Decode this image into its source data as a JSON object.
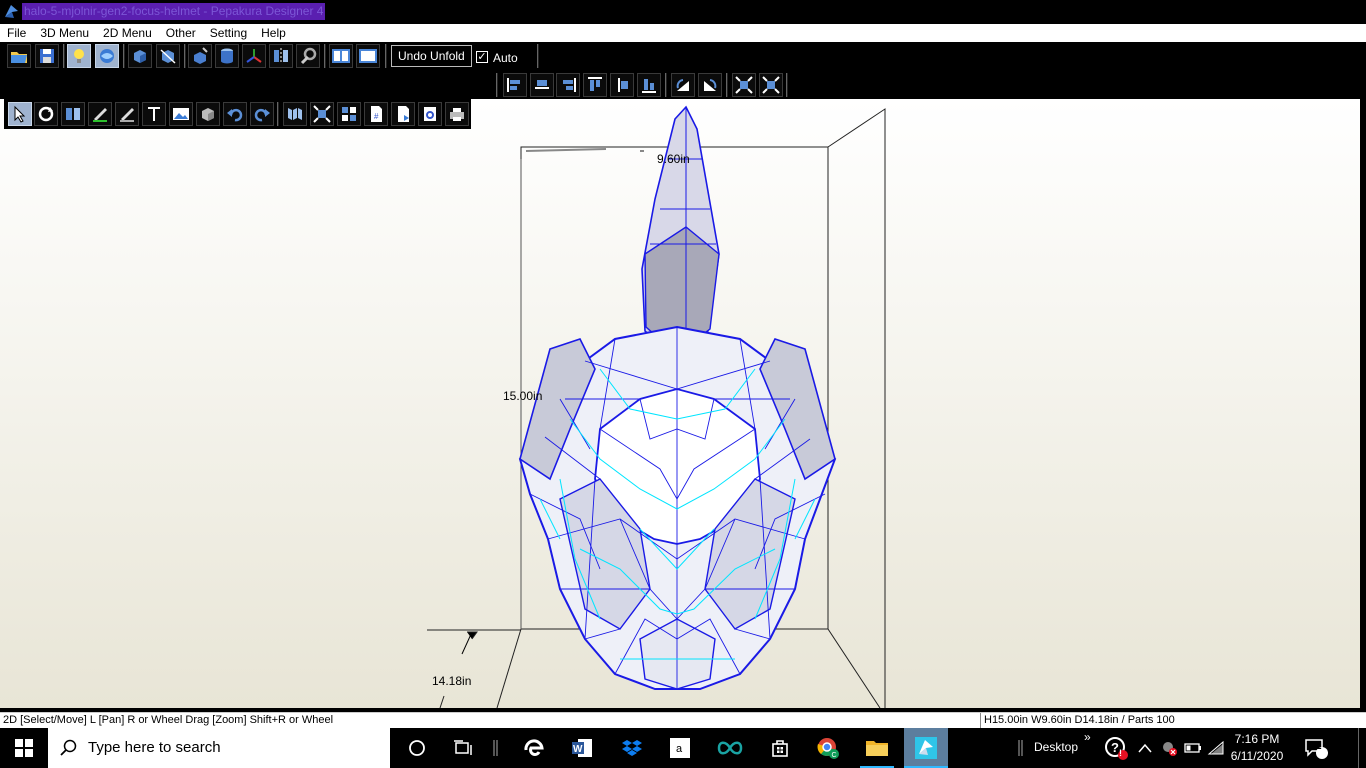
{
  "window": {
    "title": "halo-5-mjolnir-gen2-focus-helmet - Pepakura Designer 4"
  },
  "menu": [
    "File",
    "3D Menu",
    "2D Menu",
    "Other",
    "Setting",
    "Help"
  ],
  "toolbar_main": {
    "undo_unfold": "Undo Unfold",
    "auto_label": "Auto",
    "auto_checked": "✓",
    "icons": [
      "open-icon",
      "save-icon",
      "light-icon",
      "texture-icon",
      "select-face-icon",
      "edge-icon",
      "cut-icon",
      "cylinder-icon",
      "axis-icon",
      "mirror-icon",
      "settings-icon",
      "layout-2pane-icon",
      "layout-1pane-icon"
    ]
  },
  "toolbar_2d": {
    "icons": [
      "select-move-icon",
      "rotate-icon",
      "join-icon",
      "flap-icon",
      "fold-line-icon",
      "text-icon",
      "image-icon",
      "box-icon",
      "undo-icon",
      "redo-icon",
      "unfold-icon",
      "arrange-icon",
      "grid-icon",
      "page-number-icon",
      "page-icon",
      "print-preview-icon",
      "print-icon"
    ]
  },
  "toolbar_align": {
    "icons": [
      "align-left-icon",
      "align-hcenter-icon",
      "align-right-icon",
      "align-top-icon",
      "align-vcenter-icon",
      "align-bottom-icon",
      "rotate-left-icon",
      "rotate-right-icon",
      "fit-icon",
      "expand-icon"
    ]
  },
  "viewport": {
    "width_label": "9.60in",
    "height_label": "15.00in",
    "depth_label": "14.18in"
  },
  "status": {
    "hint": "2D [Select/Move] L [Pan] R or Wheel Drag [Zoom] Shift+R or Wheel",
    "dimensions": "H15.00in W9.60in D14.18in / Parts 100"
  },
  "taskbar": {
    "search_placeholder": "Type here to search",
    "desktop_label": "Desktop",
    "chevron": "»",
    "time": "7:16 PM",
    "date": "6/11/2020",
    "notification_count": "2",
    "help_badge": "!",
    "colors": {
      "accent": "#2fb8ff",
      "edge_blue": "#1a1ae6",
      "edge_cyan": "#00e5ff"
    }
  }
}
